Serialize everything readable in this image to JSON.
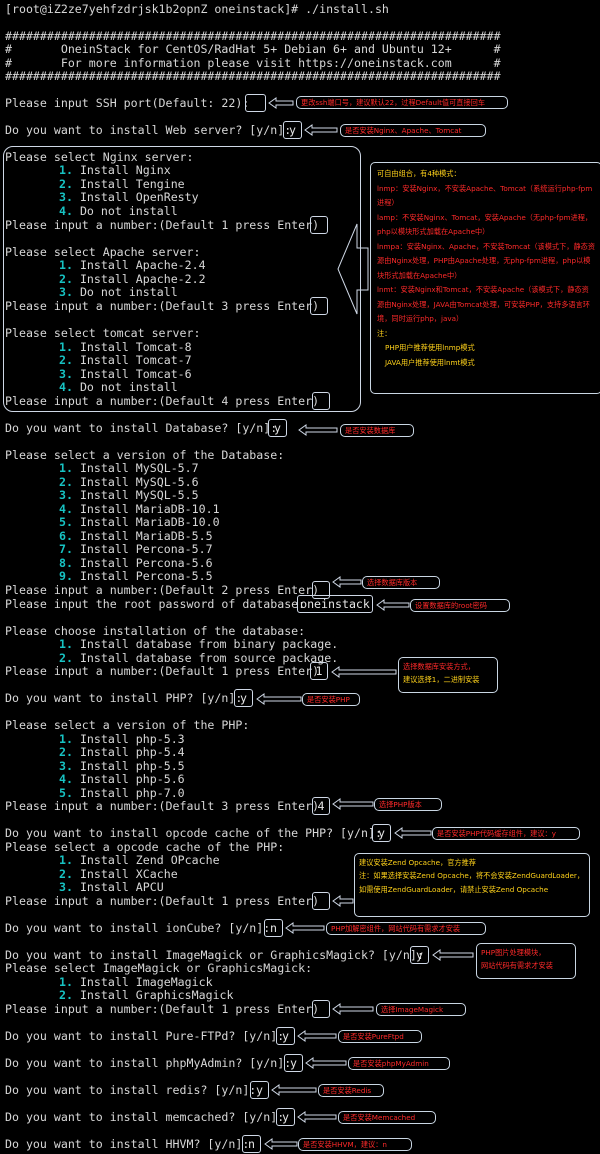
{
  "terminal": {
    "prompt": "[root@iZ2ze7yehfzdrjsk1b2opnZ oneinstack]# ./install.sh",
    "hash_line": "#######################################################################",
    "banner1": "#       OneinStack for CentOS/RadHat 5+ Debian 6+ and Ubuntu 12+      #",
    "banner2": "#       For more information please visit https://oneinstack.com      #",
    "ssh_prompt": "Please input SSH port(Default: 22):",
    "web_prompt": "Do you want to install Web server? [y/n]:",
    "nginx_title": "Please select Nginx server:",
    "nginx_options": [
      {
        "num": "1.",
        "label": "Install Nginx"
      },
      {
        "num": "2.",
        "label": "Install Tengine"
      },
      {
        "num": "3.",
        "label": "Install OpenResty"
      },
      {
        "num": "4.",
        "label": "Do not install"
      }
    ],
    "nginx_number_prompt": "Please input a number:(Default 1 press Enter)",
    "apache_title": "Please select Apache server:",
    "apache_options": [
      {
        "num": "1.",
        "label": "Install Apache-2.4"
      },
      {
        "num": "2.",
        "label": "Install Apache-2.2"
      },
      {
        "num": "3.",
        "label": "Do not install"
      }
    ],
    "apache_number_prompt": "Please input a number:(Default 3 press Enter)",
    "tomcat_title": "Please select tomcat server:",
    "tomcat_options": [
      {
        "num": "1.",
        "label": "Install Tomcat-8"
      },
      {
        "num": "2.",
        "label": "Install Tomcat-7"
      },
      {
        "num": "3.",
        "label": "Install Tomcat-6"
      },
      {
        "num": "4.",
        "label": "Do not install"
      }
    ],
    "tomcat_number_prompt": "Please input a number:(Default 4 press Enter)",
    "db_prompt": "Do you want to install Database? [y/n]:",
    "db_version_title": "Please select a version of the Database:",
    "db_options": [
      {
        "num": "1.",
        "label": "Install MySQL-5.7"
      },
      {
        "num": "2.",
        "label": "Install MySQL-5.6"
      },
      {
        "num": "3.",
        "label": "Install MySQL-5.5"
      },
      {
        "num": "4.",
        "label": "Install MariaDB-10.1"
      },
      {
        "num": "5.",
        "label": "Install MariaDB-10.0"
      },
      {
        "num": "6.",
        "label": "Install MariaDB-5.5"
      },
      {
        "num": "7.",
        "label": "Install Percona-5.7"
      },
      {
        "num": "8.",
        "label": "Install Percona-5.6"
      },
      {
        "num": "9.",
        "label": "Install Percona-5.5"
      }
    ],
    "db_number_prompt": "Please input a number:(Default 2 press Enter)",
    "db_password_prompt": "Please input the root password of database:",
    "install_method_title": "Please choose installation of the database:",
    "install_method_options": [
      {
        "num": "1.",
        "label": "Install database from binary package."
      },
      {
        "num": "2.",
        "label": "Install database from source package."
      }
    ],
    "install_method_prompt": "Please input a number:(Default 1 press Enter)",
    "php_prompt": "Do you want to install PHP? [y/n]:",
    "php_version_title": "Please select a version of the PHP:",
    "php_options": [
      {
        "num": "1.",
        "label": "Install php-5.3"
      },
      {
        "num": "2.",
        "label": "Install php-5.4"
      },
      {
        "num": "3.",
        "label": "Install php-5.5"
      },
      {
        "num": "4.",
        "label": "Install php-5.6"
      },
      {
        "num": "5.",
        "label": "Install php-7.0"
      }
    ],
    "php_number_prompt": "Please input a number:(Default 3 press Enter)",
    "opcode_prompt": "Do you want to install opcode cache of the PHP? [y/n]:",
    "opcode_title": "Please select a opcode cache of the PHP:",
    "opcode_options": [
      {
        "num": "1.",
        "label": "Install Zend OPcache"
      },
      {
        "num": "2.",
        "label": "Install XCache"
      },
      {
        "num": "3.",
        "label": "Install APCU"
      }
    ],
    "opcode_number_prompt": "Please input a number:(Default 1 press Enter)",
    "ioncube_prompt": "Do you want to install ionCube? [y/n]:",
    "imagemagick_prompt": "Do you want to install ImageMagick or GraphicsMagick? [y/n]:",
    "imagemagick_title": "Please select ImageMagick or GraphicsMagick:",
    "imagemagick_options": [
      {
        "num": "1.",
        "label": "Install ImageMagick"
      },
      {
        "num": "2.",
        "label": "Install GraphicsMagick"
      }
    ],
    "imagemagick_number_prompt": "Please input a number:(Default 1 press Enter)",
    "ftpd_prompt": "Do you want to install Pure-FTPd? [y/n]:",
    "phpmyadmin_prompt": "Do you want to install phpMyAdmin? [y/n]:",
    "redis_prompt": "Do you want to install redis? [y/n]:",
    "memcached_prompt": "Do you want to install memcached? [y/n]:",
    "hhvm_prompt": "Do you want to install HHVM? [y/n]:"
  },
  "inputs": {
    "ssh": "",
    "web": "y",
    "nginx": "",
    "apache": "",
    "tomcat": "",
    "db": "y",
    "db_version": "",
    "db_password": "oneinstack",
    "install_method": "1",
    "php": "y",
    "php_version": "4",
    "opcode": "y",
    "opcode_choice": "",
    "ioncube": "n",
    "imagemagick": "y",
    "imagemagick_choice": "",
    "ftpd": "y",
    "phpmyadmin": "y",
    "redis": "y",
    "memcached": "y",
    "hhvm": "n"
  },
  "notes": {
    "ssh": "更改ssh端口号，建议默认22，过程Default值可直接回车",
    "web": "是否安装Nginx、Apache、Tomcat",
    "modes": [
      "可自由组合，有4种模式：",
      "lnmp：安装Nginx，不安装Apache、Tomcat（系统运行php-fpm进程）",
      "lamp：不安装Nginx、Tomcat，安装Apache（无php-fpm进程，php以模块形式加载在Apache中）",
      "lnmpa：安装Nginx、Apache，不安装Tomcat（该模式下，静态资源由Nginx处理，PHP由Apache处理，无php-fpm进程，php以模块形式加载在Apache中）",
      "lnmt：安装Nginx和Tomcat，不安装Apache（该模式下，静态资源由Nginx处理，JAVA由Tomcat处理，可安装PHP，支持多语言环境，同时运行php，java）",
      "注：",
      "PHP用户推荐使用lnmp模式",
      "JAVA用户推荐使用lnmt模式"
    ],
    "db": "是否安装数据库",
    "db_version": "选择数据库版本",
    "db_password": "设置数据库的root密码",
    "install_method": [
      "选择数据库安装方式，",
      "建议选择1，二进制安装"
    ],
    "php": "是否安装PHP",
    "php_version": "选择PHP版本",
    "opcode": "是否安装PHP代码缓存组件，建议：y",
    "opcode_detail": [
      "建议安装Zend Opcache，官方推荐",
      "注：如果选择安装Zend Opcache，将不会安装ZendGuardLoader，如需使用ZendGuardLoader，请禁止安装Zend Opcache"
    ],
    "ioncube": "PHP加解密组件，网站代码有需求才安装",
    "imagemagick": [
      "PHP图片处理模块，",
      "网站代码有需求才安装"
    ],
    "imagemagick_choice": "选择ImageMagick",
    "ftpd": "是否安装PureFtpd",
    "phpmyadmin": "是否安装phpMyAdmin",
    "redis": "是否安装Redis",
    "memcached": "是否安装Memcached",
    "hhvm": "是否安装HHVM，建议：n"
  },
  "colors": {
    "background": "#000000",
    "text": "#d7d7d7",
    "option_number": "#17c3c3",
    "note_red": "#ff2a2a",
    "note_yellow": "#ffd21a",
    "box_border": "#cfd8e6"
  }
}
